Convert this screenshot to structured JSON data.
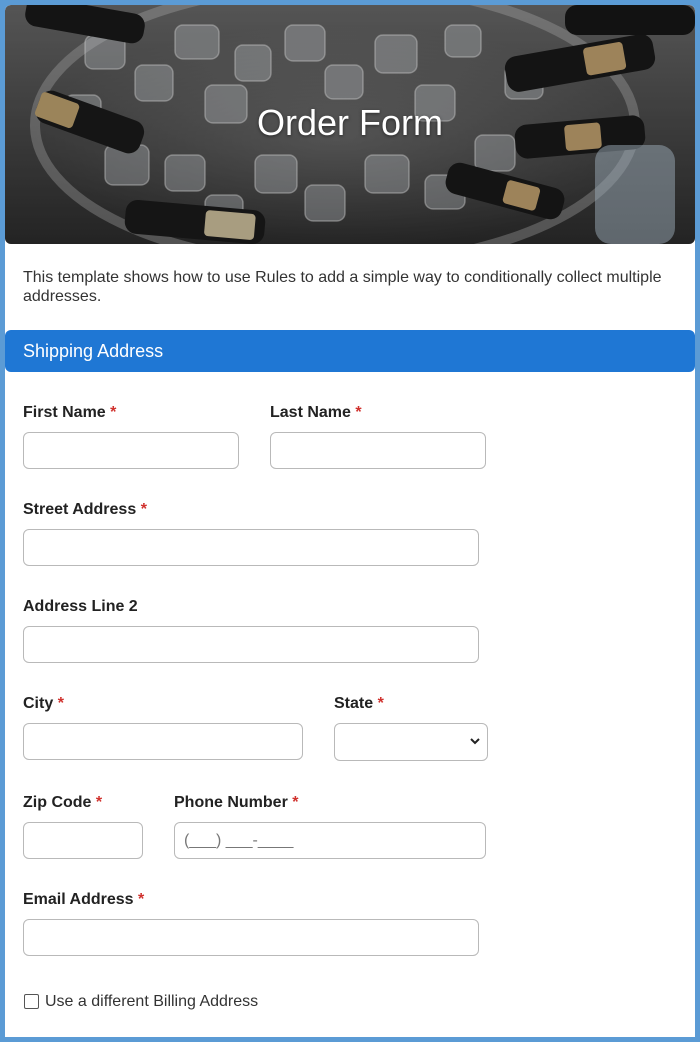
{
  "hero": {
    "title": "Order Form"
  },
  "intro": {
    "text": "This template shows how to use Rules to add a simple way to conditionally collect multiple addresses."
  },
  "shipping": {
    "section_title": "Shipping Address",
    "fields": {
      "first_name": {
        "label": "First Name",
        "required_mark": "*",
        "value": ""
      },
      "last_name": {
        "label": "Last Name",
        "required_mark": "*",
        "value": ""
      },
      "street_address": {
        "label": "Street Address",
        "required_mark": "*",
        "value": ""
      },
      "address_line_2": {
        "label": "Address Line 2",
        "value": ""
      },
      "city": {
        "label": "City",
        "required_mark": "*",
        "value": ""
      },
      "state": {
        "label": "State",
        "required_mark": "*",
        "selected": ""
      },
      "zip_code": {
        "label": "Zip Code",
        "required_mark": "*",
        "value": ""
      },
      "phone_number": {
        "label": "Phone Number",
        "required_mark": "*",
        "mask": "(___) ___-____"
      },
      "email_address": {
        "label": "Email Address",
        "required_mark": "*",
        "value": ""
      }
    }
  },
  "billing_toggle": {
    "label": "Use a different Billing Address",
    "checked": false
  },
  "colors": {
    "page_border": "#5b9bd5",
    "section_bar": "#1f77d4",
    "required": "#d0312d"
  }
}
